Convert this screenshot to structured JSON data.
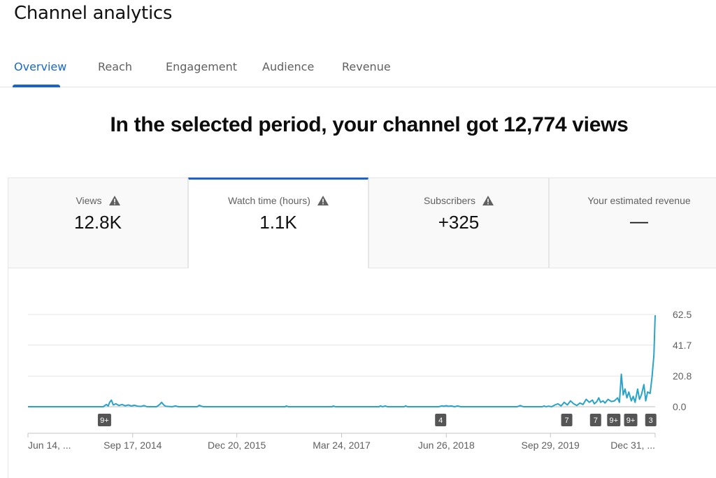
{
  "page": {
    "title": "Channel analytics"
  },
  "tabs": [
    {
      "label": "Overview",
      "active": true
    },
    {
      "label": "Reach",
      "active": false
    },
    {
      "label": "Engagement",
      "active": false
    },
    {
      "label": "Audience",
      "active": false
    },
    {
      "label": "Revenue",
      "active": false
    }
  ],
  "headline": "In the selected period, your channel got 12,774 views",
  "cards": [
    {
      "label": "Views",
      "value": "12.8K",
      "warning": true,
      "active": false
    },
    {
      "label": "Watch time (hours)",
      "value": "1.1K",
      "warning": true,
      "active": true
    },
    {
      "label": "Subscribers",
      "value": "+325",
      "warning": true,
      "active": false
    },
    {
      "label": "Your estimated revenue",
      "value": "—",
      "warning": false,
      "active": false
    }
  ],
  "colors": {
    "accent": "#1a64c8",
    "line": "#2aa3c9",
    "badge": "#555555"
  },
  "chart_data": {
    "type": "line",
    "title": "",
    "metric": "Watch time (hours)",
    "xlabel": "",
    "ylabel": "",
    "ylim": [
      0,
      62.5
    ],
    "y_ticks": [
      "62.5",
      "41.7",
      "20.8",
      "0.0"
    ],
    "y_tick_values": [
      62.5,
      41.7,
      20.8,
      0.0
    ],
    "x_ticks": [
      "Jun 14, ...",
      "Sep 17, 2014",
      "Dec 20, 2015",
      "Mar 24, 2017",
      "Jun 26, 2018",
      "Sep 29, 2019",
      "Dec 31, ..."
    ],
    "x_tick_positions": [
      0,
      0.167,
      0.333,
      0.5,
      0.667,
      0.833,
      1.0
    ],
    "grid": true,
    "series": [
      {
        "name": "Watch time (hours)",
        "points": [
          [
            0.0,
            0
          ],
          [
            0.12,
            0
          ],
          [
            0.125,
            1.5
          ],
          [
            0.128,
            0.5
          ],
          [
            0.13,
            2.8
          ],
          [
            0.133,
            4.5
          ],
          [
            0.136,
            1.2
          ],
          [
            0.14,
            2
          ],
          [
            0.145,
            0.8
          ],
          [
            0.15,
            1.5
          ],
          [
            0.155,
            0.6
          ],
          [
            0.16,
            1.2
          ],
          [
            0.165,
            0.5
          ],
          [
            0.17,
            1
          ],
          [
            0.175,
            0.4
          ],
          [
            0.18,
            0.2
          ],
          [
            0.185,
            0.8
          ],
          [
            0.19,
            0
          ],
          [
            0.205,
            0
          ],
          [
            0.21,
            1.5
          ],
          [
            0.213,
            3
          ],
          [
            0.217,
            1
          ],
          [
            0.22,
            0.3
          ],
          [
            0.23,
            0
          ],
          [
            0.235,
            0.5
          ],
          [
            0.24,
            0
          ],
          [
            0.27,
            0
          ],
          [
            0.273,
            1
          ],
          [
            0.277,
            0.3
          ],
          [
            0.28,
            0
          ],
          [
            0.41,
            0
          ],
          [
            0.412,
            0.5
          ],
          [
            0.415,
            0
          ],
          [
            0.485,
            0
          ],
          [
            0.487,
            0.5
          ],
          [
            0.49,
            0
          ],
          [
            0.56,
            0
          ],
          [
            0.562,
            0.6
          ],
          [
            0.565,
            0
          ],
          [
            0.57,
            0.5
          ],
          [
            0.573,
            0
          ],
          [
            0.6,
            0
          ],
          [
            0.602,
            0.6
          ],
          [
            0.605,
            0
          ],
          [
            0.655,
            0
          ],
          [
            0.66,
            0.6
          ],
          [
            0.663,
            0.3
          ],
          [
            0.667,
            0.7
          ],
          [
            0.67,
            0.3
          ],
          [
            0.675,
            0.5
          ],
          [
            0.68,
            0
          ],
          [
            0.685,
            0.5
          ],
          [
            0.69,
            0
          ],
          [
            0.78,
            0
          ],
          [
            0.785,
            0.8
          ],
          [
            0.79,
            0
          ],
          [
            0.82,
            0
          ],
          [
            0.823,
            0.5
          ],
          [
            0.826,
            0
          ],
          [
            0.83,
            0.4
          ],
          [
            0.835,
            0
          ],
          [
            0.84,
            1.2
          ],
          [
            0.845,
            2
          ],
          [
            0.85,
            0.5
          ],
          [
            0.855,
            3
          ],
          [
            0.86,
            1.2
          ],
          [
            0.865,
            4
          ],
          [
            0.87,
            2
          ],
          [
            0.875,
            0.8
          ],
          [
            0.88,
            2.5
          ],
          [
            0.885,
            1.5
          ],
          [
            0.89,
            5
          ],
          [
            0.895,
            3
          ],
          [
            0.9,
            4.5
          ],
          [
            0.903,
            2
          ],
          [
            0.907,
            3.5
          ],
          [
            0.91,
            6
          ],
          [
            0.913,
            3
          ],
          [
            0.917,
            4
          ],
          [
            0.92,
            2.5
          ],
          [
            0.925,
            5
          ],
          [
            0.93,
            3.5
          ],
          [
            0.935,
            4
          ],
          [
            0.94,
            6
          ],
          [
            0.943,
            3
          ],
          [
            0.946,
            22
          ],
          [
            0.949,
            8
          ],
          [
            0.952,
            12
          ],
          [
            0.955,
            6
          ],
          [
            0.958,
            10
          ],
          [
            0.962,
            4
          ],
          [
            0.965,
            7
          ],
          [
            0.968,
            3
          ],
          [
            0.972,
            12
          ],
          [
            0.975,
            5
          ],
          [
            0.978,
            8
          ],
          [
            0.982,
            15
          ],
          [
            0.985,
            4
          ],
          [
            0.988,
            10
          ],
          [
            0.992,
            9
          ],
          [
            0.995,
            20
          ],
          [
            0.998,
            35
          ],
          [
            1.0,
            62
          ]
        ]
      }
    ],
    "annotations": [
      {
        "label": "9+",
        "x": 0.122
      },
      {
        "label": "4",
        "x": 0.658
      },
      {
        "label": "7",
        "x": 0.859
      },
      {
        "label": "7",
        "x": 0.905
      },
      {
        "label": "9+",
        "x": 0.934
      },
      {
        "label": "9+",
        "x": 0.961
      },
      {
        "label": "3",
        "x": 0.993
      }
    ]
  }
}
